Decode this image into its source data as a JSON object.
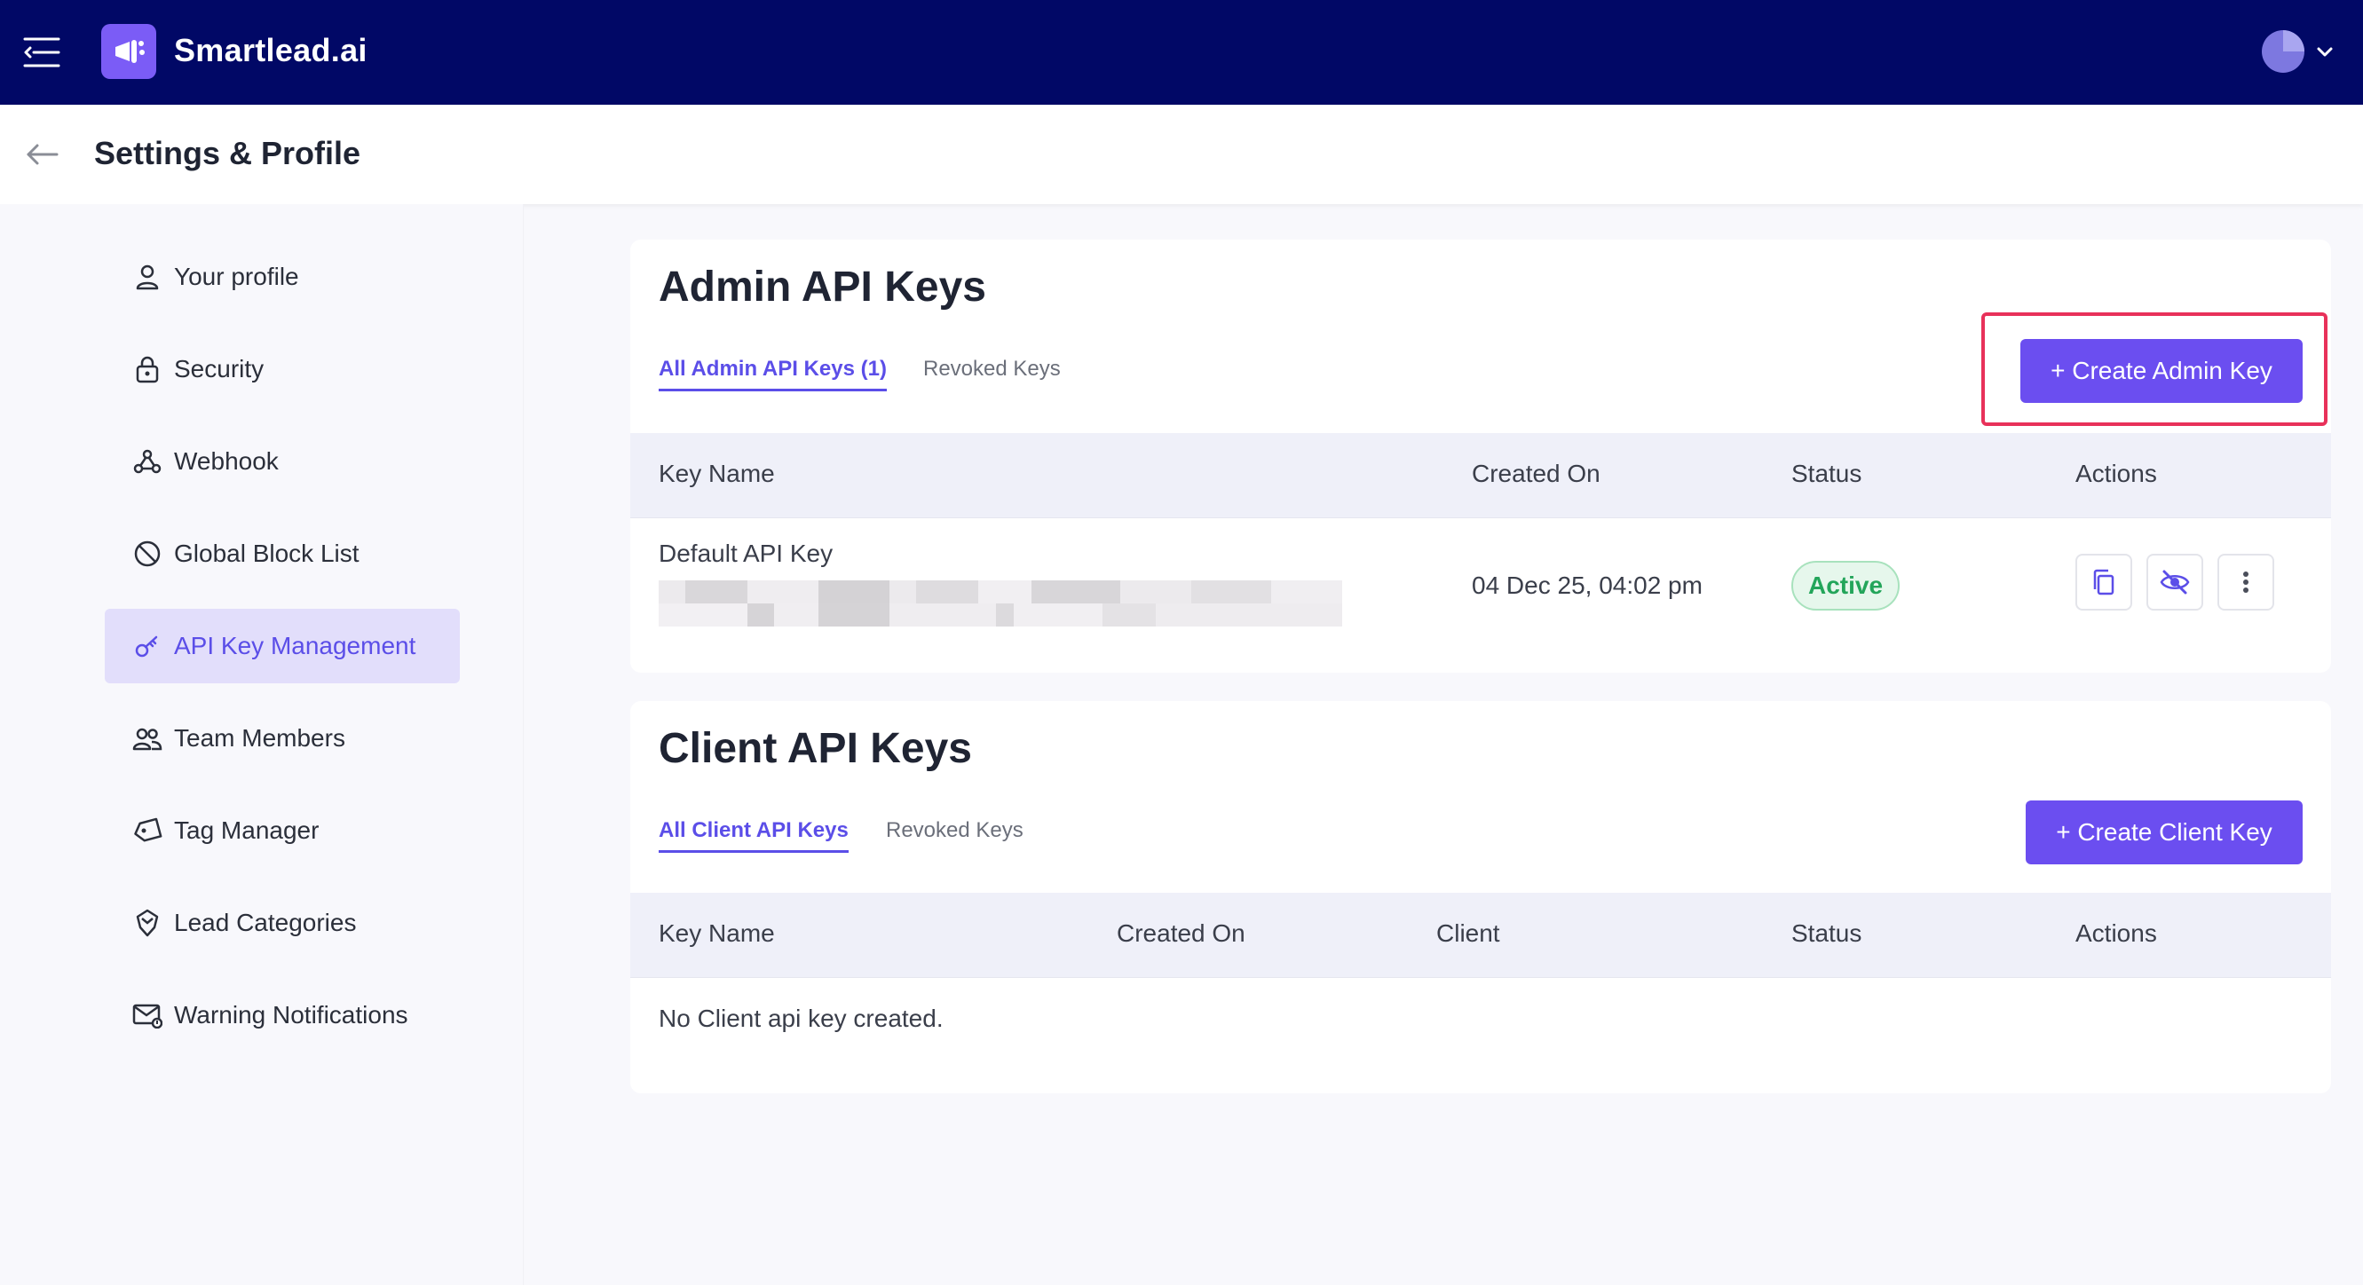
{
  "app": {
    "brand": "Smartlead.ai"
  },
  "header": {
    "title": "Settings & Profile"
  },
  "sidebar": {
    "items": [
      {
        "label": "Your profile",
        "icon": "user-icon"
      },
      {
        "label": "Security",
        "icon": "lock-icon"
      },
      {
        "label": "Webhook",
        "icon": "webhook-icon"
      },
      {
        "label": "Global Block List",
        "icon": "block-icon"
      },
      {
        "label": "API Key Management",
        "icon": "key-icon",
        "active": true
      },
      {
        "label": "Team Members",
        "icon": "team-icon"
      },
      {
        "label": "Tag Manager",
        "icon": "tag-icon"
      },
      {
        "label": "Lead Categories",
        "icon": "category-icon"
      },
      {
        "label": "Warning Notifications",
        "icon": "mail-alert-icon"
      }
    ]
  },
  "admin": {
    "title": "Admin API Keys",
    "tabs": [
      "All Admin API Keys (1)",
      "Revoked Keys"
    ],
    "create_button": "+ Create Admin Key",
    "columns": [
      "Key Name",
      "Created On",
      "Status",
      "Actions"
    ],
    "rows": [
      {
        "name": "Default API Key",
        "created_on": "04 Dec 25, 04:02 pm",
        "status": "Active"
      }
    ]
  },
  "client": {
    "title": "Client API Keys",
    "tabs": [
      "All Client API Keys",
      "Revoked Keys"
    ],
    "create_button": "+ Create Client Key",
    "columns": [
      "Key Name",
      "Created On",
      "Client",
      "Status",
      "Actions"
    ],
    "empty_message": "No Client api key created."
  },
  "colors": {
    "topbar": "#010866",
    "accent": "#6b4ef0",
    "highlight": "#e8315a",
    "status_active": "#23a55a"
  }
}
